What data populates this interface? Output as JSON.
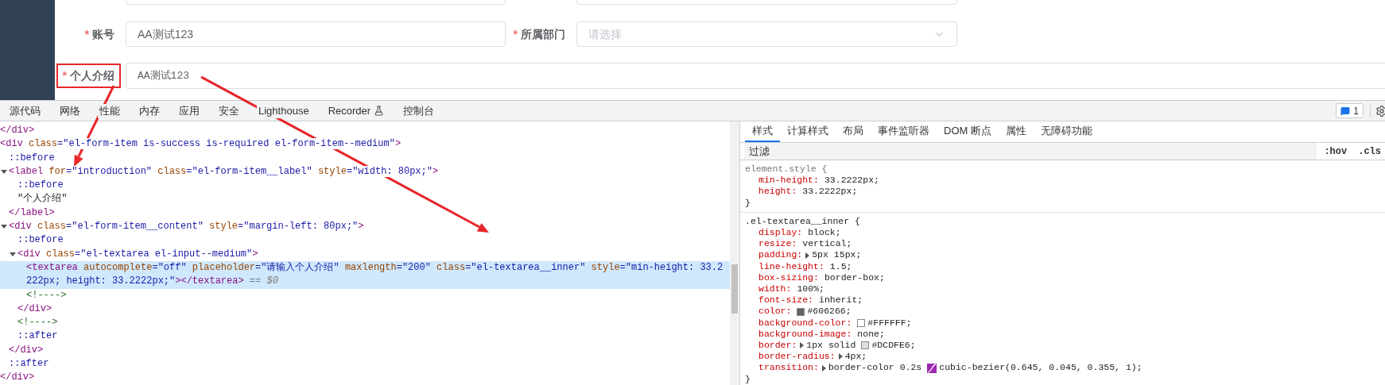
{
  "form": {
    "rows": [
      {
        "fields": [
          {
            "kind": "input",
            "marker": "*",
            "label": "账号",
            "value": "AA测试123",
            "highlighted": false
          },
          {
            "kind": "select",
            "marker": "*",
            "label": "所属部门",
            "placeholder": "请选择",
            "highlighted": false
          }
        ]
      },
      {
        "fields": [
          {
            "kind": "textarea",
            "marker": "*",
            "label": "个人介绍",
            "value": "AA测试123",
            "highlighted": true
          }
        ]
      }
    ]
  },
  "devtools": {
    "tabs": [
      {
        "label": "源代码",
        "kind": "plain",
        "selected": false
      },
      {
        "label": "网络",
        "kind": "plain",
        "selected": false
      },
      {
        "label": "性能",
        "kind": "plain",
        "selected": false
      },
      {
        "label": "内存",
        "kind": "plain",
        "selected": false
      },
      {
        "label": "应用",
        "kind": "plain",
        "selected": false
      },
      {
        "label": "安全",
        "kind": "plain",
        "selected": false
      },
      {
        "label": "Lighthouse",
        "kind": "plain",
        "selected": false
      },
      {
        "label": "Recorder",
        "kind": "experimental",
        "selected": false
      },
      {
        "label": "控制台",
        "kind": "plain",
        "selected": false
      }
    ],
    "issues_badge": "1",
    "elements": [
      {
        "selected": false,
        "parts": [
          {
            "kind": "tag",
            "text": "</div>"
          }
        ]
      },
      {
        "selected": false,
        "parts": [
          {
            "kind": "tag",
            "text": "<div"
          },
          {
            "kind": "attr",
            "text": " class"
          },
          {
            "kind": "value",
            "text": "=\"el-form-item is-success is-required el-form-item--medium\""
          },
          {
            "kind": "tag",
            "text": ">"
          }
        ],
        "children": [
          {
            "selected": false,
            "parts": [
              {
                "kind": "pseudo",
                "text": "::before"
              }
            ]
          },
          {
            "selected": false,
            "expanded": true,
            "parts": [
              {
                "kind": "tag",
                "text": "<label"
              },
              {
                "kind": "attr",
                "text": " for"
              },
              {
                "kind": "value",
                "text": "=\"introduction\""
              },
              {
                "kind": "attr",
                "text": " class"
              },
              {
                "kind": "value",
                "text": "=\"el-form-item__label\""
              },
              {
                "kind": "attr",
                "text": " style"
              },
              {
                "kind": "value",
                "text": "=\"width: 80px;\""
              },
              {
                "kind": "tag",
                "text": ">"
              }
            ],
            "children": [
              {
                "selected": false,
                "parts": [
                  {
                    "kind": "pseudo",
                    "text": "::before"
                  }
                ]
              },
              {
                "selected": false,
                "parts": [
                  {
                    "kind": "text",
                    "text": "\"个人介绍\""
                  }
                ]
              }
            ]
          },
          {
            "selected": false,
            "parts": [
              {
                "kind": "tag",
                "text": "</label>"
              }
            ]
          },
          {
            "selected": false,
            "expanded": true,
            "parts": [
              {
                "kind": "tag",
                "text": "<div"
              },
              {
                "kind": "attr",
                "text": " class"
              },
              {
                "kind": "value",
                "text": "=\"el-form-item__content\""
              },
              {
                "kind": "attr",
                "text": " style"
              },
              {
                "kind": "value",
                "text": "=\"margin-left: 80px;\""
              },
              {
                "kind": "tag",
                "text": ">"
              }
            ],
            "children": [
              {
                "selected": false,
                "parts": [
                  {
                    "kind": "pseudo",
                    "text": "::before"
                  }
                ]
              },
              {
                "selected": false,
                "expanded": true,
                "parts": [
                  {
                    "kind": "tag",
                    "text": "<div"
                  },
                  {
                    "kind": "attr",
                    "text": " class"
                  },
                  {
                    "kind": "value",
                    "text": "=\"el-textarea el-input--medium\""
                  },
                  {
                    "kind": "tag",
                    "text": ">"
                  }
                ],
                "children": [
                  {
                    "selected": true,
                    "parts": [
                      {
                        "kind": "tag",
                        "text": "<textarea"
                      },
                      {
                        "kind": "attr",
                        "text": " autocomplete"
                      },
                      {
                        "kind": "value",
                        "text": "=\"off\""
                      },
                      {
                        "kind": "attr",
                        "text": " placeholder"
                      },
                      {
                        "kind": "value",
                        "text": "=\"请输入个人介绍\""
                      },
                      {
                        "kind": "attr",
                        "text": " maxlength"
                      },
                      {
                        "kind": "value",
                        "text": "=\"200\""
                      },
                      {
                        "kind": "attr",
                        "text": " class"
                      },
                      {
                        "kind": "value",
                        "text": "=\"el-textarea__inner\""
                      },
                      {
                        "kind": "attr",
                        "text": " style"
                      },
                      {
                        "kind": "value",
                        "text": "=\"min-height: 33.2222px; height: 33.2222px;\""
                      },
                      {
                        "kind": "tag",
                        "text": "></textarea>"
                      },
                      {
                        "kind": "hint",
                        "text": " == $0"
                      }
                    ]
                  },
                  {
                    "selected": false,
                    "parts": [
                      {
                        "kind": "comment",
                        "text": "<!---->"
                      }
                    ]
                  }
                ]
              },
              {
                "selected": false,
                "parts": [
                  {
                    "kind": "tag",
                    "text": "</div>"
                  }
                ]
              },
              {
                "selected": false,
                "parts": [
                  {
                    "kind": "comment",
                    "text": "<!---->"
                  }
                ]
              },
              {
                "selected": false,
                "parts": [
                  {
                    "kind": "pseudo",
                    "text": "::after"
                  }
                ]
              }
            ]
          },
          {
            "selected": false,
            "parts": [
              {
                "kind": "tag",
                "text": "</div>"
              }
            ]
          },
          {
            "selected": false,
            "parts": [
              {
                "kind": "pseudo",
                "text": "::after"
              }
            ]
          }
        ]
      },
      {
        "selected": false,
        "parts": [
          {
            "kind": "tag",
            "text": "</div>"
          }
        ]
      }
    ],
    "style_tabs": [
      {
        "label": "样式",
        "selected": true
      },
      {
        "label": "计算样式",
        "selected": false
      },
      {
        "label": "布局",
        "selected": false
      },
      {
        "label": "事件监听器",
        "selected": false
      },
      {
        "label": "DOM 断点",
        "selected": false
      },
      {
        "label": "属性",
        "selected": false
      },
      {
        "label": "无障碍功能",
        "selected": false
      }
    ],
    "filter": {
      "placeholder": "过滤"
    },
    "filter_buttons": [
      ":hov",
      ".cls"
    ],
    "rules": [
      {
        "selector": "element.style {",
        "close": "}",
        "properties": [
          {
            "name": "min-height:",
            "value": "33.2222px;",
            "expandable": false
          },
          {
            "name": "height:",
            "value": "33.2222px;",
            "expandable": false
          }
        ]
      },
      {
        "selector": ".el-textarea__inner {",
        "close": "}",
        "properties": [
          {
            "name": "display:",
            "value": "block;",
            "expandable": false
          },
          {
            "name": "resize:",
            "value": "vertical;",
            "expandable": false
          },
          {
            "name": "padding:",
            "value": "5px 15px;",
            "expandable": true
          },
          {
            "name": "line-height:",
            "value": "1.5;",
            "expandable": false
          },
          {
            "name": "box-sizing:",
            "value": "border-box;",
            "expandable": false
          },
          {
            "name": "width:",
            "value": "100%;",
            "expandable": false
          },
          {
            "name": "font-size:",
            "value": "inherit;",
            "expandable": false
          },
          {
            "name": "color:",
            "expandable": false,
            "swatch": {
              "kind": "color",
              "color": "#606266"
            },
            "swatch_text": "#606266;"
          },
          {
            "name": "background-color:",
            "expandable": false,
            "swatch": {
              "kind": "color",
              "color": "#ffffff"
            },
            "swatch_text": "#FFFFFF;"
          },
          {
            "name": "background-image:",
            "value": "none;",
            "expandable": false
          },
          {
            "name": "border:",
            "value": "1px solid",
            "expandable": true,
            "swatch": {
              "kind": "color",
              "color": "#dcdfe6"
            },
            "swatch_text": "#DCDFE6;"
          },
          {
            "name": "border-radius:",
            "value": "4px;",
            "expandable": true
          },
          {
            "name": "transition:",
            "value": "border-color 0.2s",
            "expandable": true,
            "swatch": {
              "kind": "easing"
            },
            "swatch_text": "cubic-bezier(0.645, 0.045, 0.355, 1);"
          }
        ]
      }
    ]
  }
}
